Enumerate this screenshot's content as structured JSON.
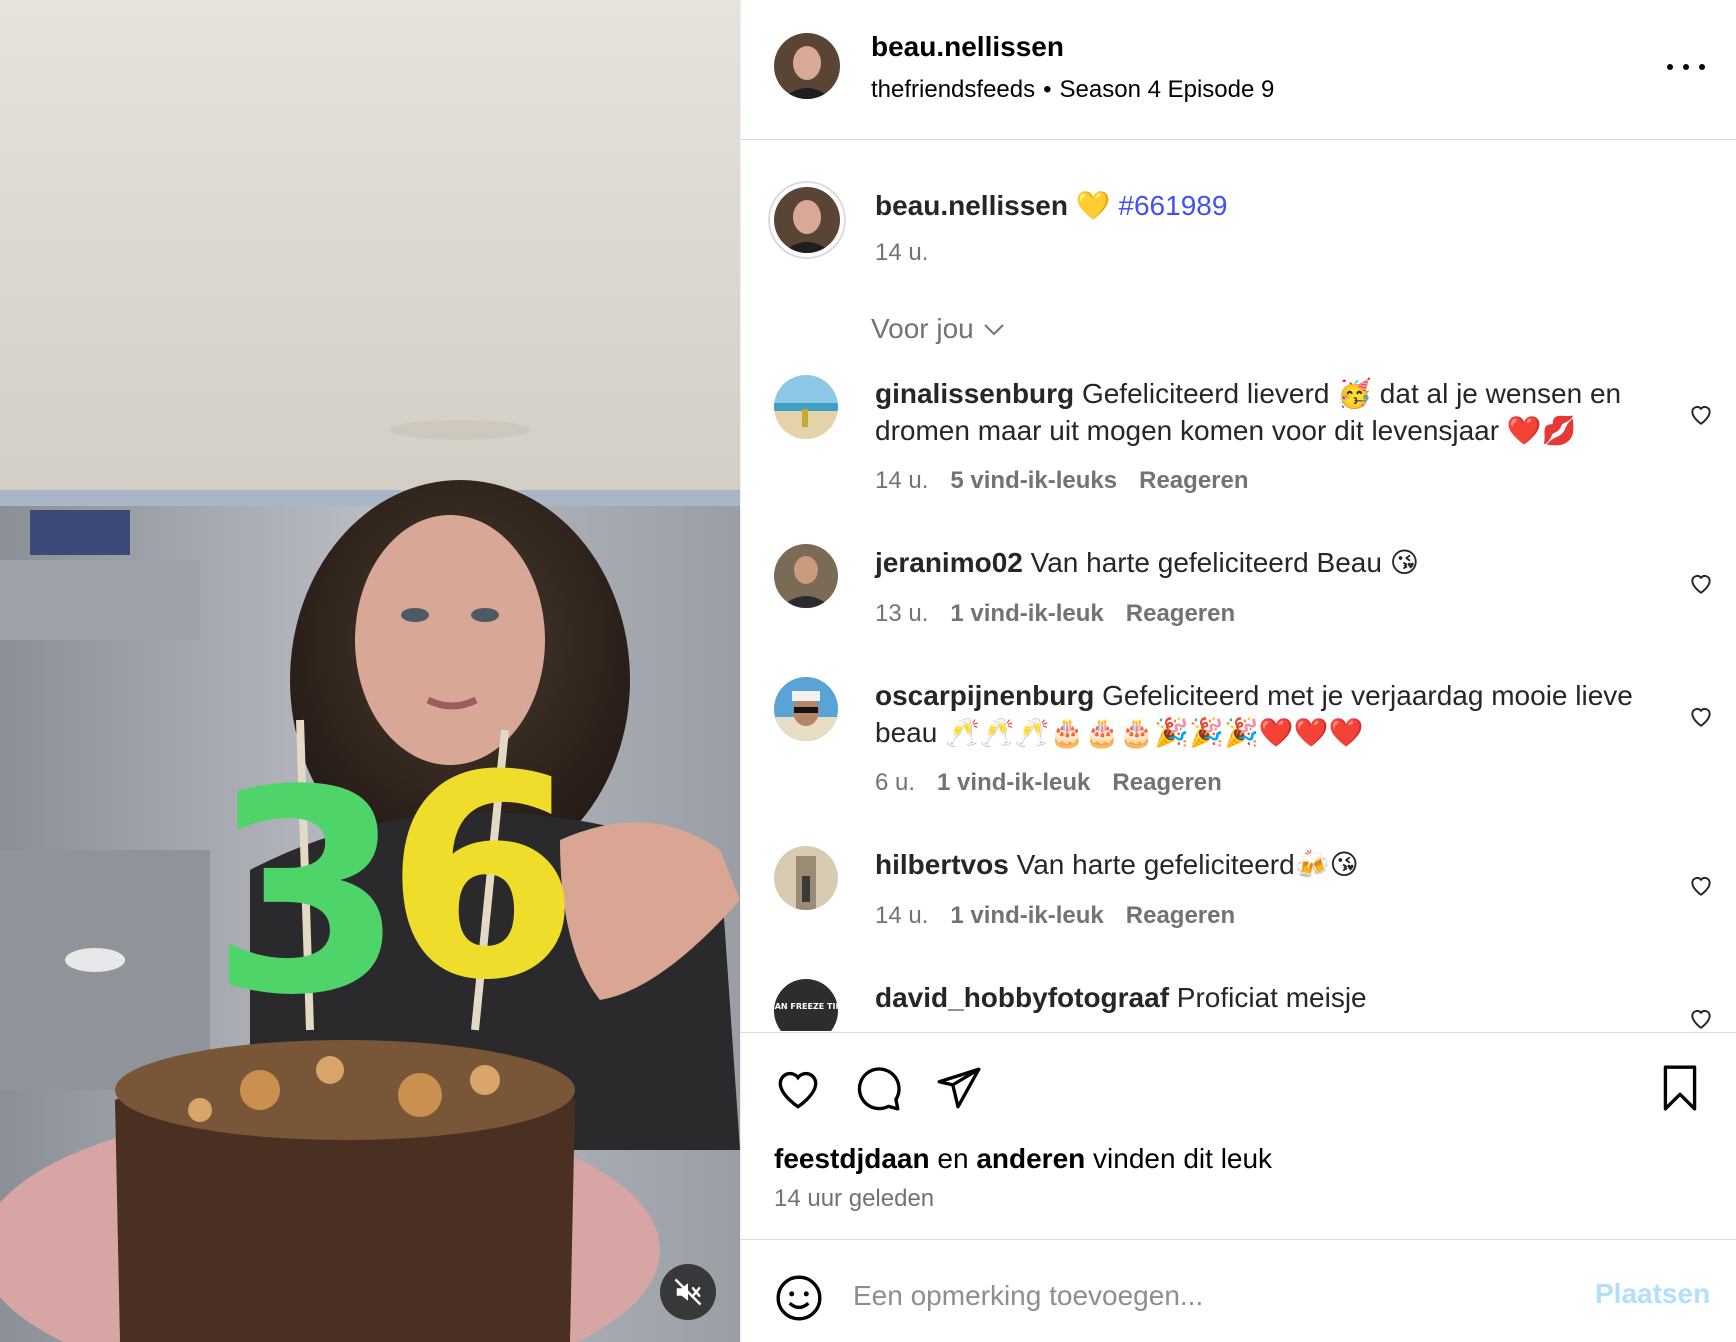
{
  "header": {
    "username": "beau.nellissen",
    "audio_source": "thefriendsfeeds",
    "separator": "•",
    "audio_title": "Season 4 Episode 9",
    "more_icon": "more-horizontal-icon"
  },
  "caption": {
    "username": "beau.nellissen",
    "emoji": "💛",
    "hashtag": "#661989",
    "time": "14 u."
  },
  "sort": {
    "label": "Voor jou",
    "icon": "chevron-down-icon"
  },
  "comments": [
    {
      "username": "ginalissenburg",
      "text": "Gefeliciteerd lieverd 🥳 dat al je wensen en dromen maar uit mogen komen voor dit levensjaar ❤️💋",
      "time": "14 u.",
      "likes": "5 vind-ik-leuks",
      "reply": "Reageren"
    },
    {
      "username": "jeranimo02",
      "text": "Van harte gefeliciteerd Beau 😘",
      "time": "13 u.",
      "likes": "1 vind-ik-leuk",
      "reply": "Reageren"
    },
    {
      "username": "oscarpijnenburg",
      "text": "Gefeliciteerd met je verjaardag mooie lieve beau 🥂🥂🥂🎂🎂🎂🎉🎉🎉❤️❤️❤️",
      "time": "6 u.",
      "likes": "1 vind-ik-leuk",
      "reply": "Reageren"
    },
    {
      "username": "hilbertvos",
      "text": "Van harte gefeliciteerd🍻😘",
      "time": "14 u.",
      "likes": "1 vind-ik-leuk",
      "reply": "Reageren"
    },
    {
      "username": "david_hobbyfotograaf",
      "text": "Proficiat meisje",
      "avatar_text": "I CAN FREEZE TIME"
    }
  ],
  "actions": {
    "like_icon": "heart-icon",
    "comment_icon": "comment-icon",
    "share_icon": "send-icon",
    "save_icon": "bookmark-icon"
  },
  "liked_by": {
    "user": "feestdjdaan",
    "conj": "en",
    "others": "anderen",
    "suffix": "vinden dit leuk"
  },
  "post_date": "14 uur geleden",
  "comment_box": {
    "placeholder": "Een opmerking toevoegen...",
    "post_label": "Plaatsen",
    "emoji_icon": "smiley-icon"
  },
  "media": {
    "mute_icon": "muted-speaker-icon"
  },
  "colors": {
    "link": "#4150f7",
    "secondary_text": "#737373",
    "post_button_disabled": "#b2dffc"
  }
}
